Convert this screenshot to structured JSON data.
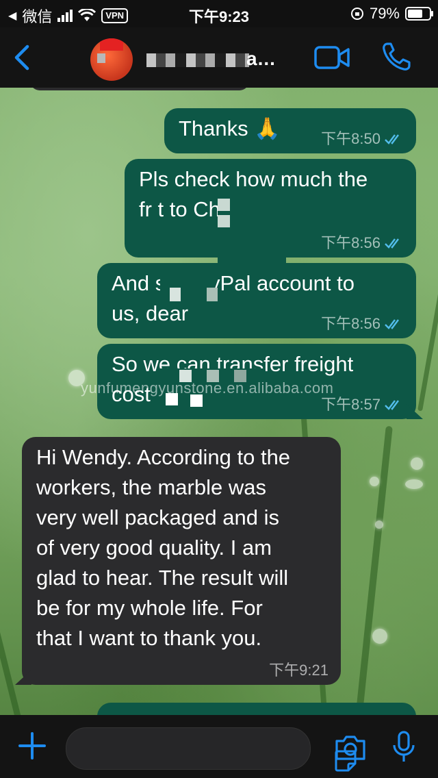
{
  "status_bar": {
    "carrier": "微信",
    "vpn": "VPN",
    "time": "下午9:23",
    "battery": "79%",
    "battery_level": 0.79
  },
  "header": {
    "contact_name": "a...",
    "back_icon": "chevron-left-icon",
    "video_icon": "video-camera-icon",
    "call_icon": "phone-icon"
  },
  "messages": [
    {
      "direction": "out",
      "text": "Thanks 🙏",
      "time": "下午8:50",
      "status": "read"
    },
    {
      "direction": "out",
      "line1": "Pls check how much the",
      "line2": "fr        t to China",
      "time": "下午8:56",
      "status": "read"
    },
    {
      "direction": "out",
      "line1": "And se   PayPal account to",
      "line2": "us, dear",
      "time": "下午8:56",
      "status": "read"
    },
    {
      "direction": "out",
      "line1": "So we can transfer freight",
      "line2": "cost",
      "time": "下午8:57",
      "status": "read"
    },
    {
      "direction": "in",
      "lines": [
        "Hi Wendy. According to the",
        "workers, the marble was",
        "very well packaged and is",
        "of very good quality. I am",
        "glad to hear. The result will",
        "be for my whole life. For",
        "that I want to thank you."
      ],
      "time": "下午9:21"
    }
  ],
  "watermark": "yunfumengyunstone.en.alibaba.com",
  "input_bar": {
    "plus_icon": "plus-icon",
    "sticker_icon": "sticker-icon",
    "camera_icon": "camera-icon",
    "mic_icon": "microphone-icon"
  },
  "colors": {
    "accent": "#1e8cf0",
    "outgoing_bubble": "#0d5746",
    "incoming_bubble": "#2b2b2d",
    "read_ticks": "#53bdeb"
  }
}
